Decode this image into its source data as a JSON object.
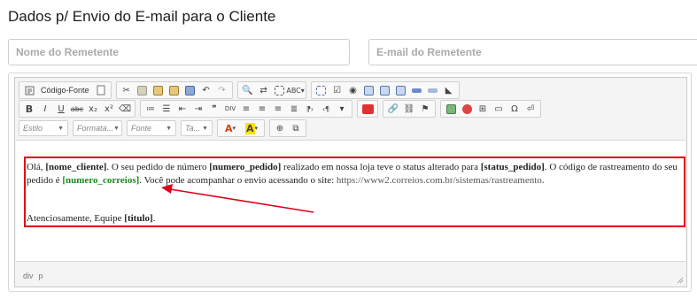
{
  "page": {
    "title": "Dados p/ Envio do E-mail para o Cliente"
  },
  "form": {
    "sender_name_placeholder": "Nome do Remetente",
    "sender_email_placeholder": "E-mail do Remetente"
  },
  "toolbar": {
    "source_label": "Código-Fonte",
    "bold": "B",
    "italic": "I",
    "underline": "U",
    "strike": "abc",
    "subscript": "x₂",
    "superscript": "x²",
    "style_combo": "Estilo",
    "format_combo": "Formata...",
    "font_combo": "Fonte",
    "size_combo": "Ta...",
    "text_color": "A",
    "bg_color": "A"
  },
  "message": {
    "p1_a": "Olá, ",
    "p1_b": "[nome_cliente]",
    "p1_c": ". O seu pedido de número ",
    "p1_d": "[numero_pedido]",
    "p1_e": " realizado em nossa loja teve o status alterado para ",
    "p1_f": "[status_pedido]",
    "p1_g": ". O código de rastreamento do seu pedido é ",
    "p1_h": "[numero_correios]",
    "p1_i": ". Você pode acompanhar o envio acessando o site: ",
    "p1_j": "https://www2.correios.com.br/sistemas/rastreamento",
    "p1_k": ".",
    "p2_a": "Atenciosamente, Equipe ",
    "p2_b": "[titulo]",
    "p2_c": "."
  },
  "statusbar": {
    "path_1": "div",
    "path_2": "p"
  },
  "colors": {
    "highlight_box": "#e0001a",
    "placeholder_green": "#1a8a1a"
  }
}
